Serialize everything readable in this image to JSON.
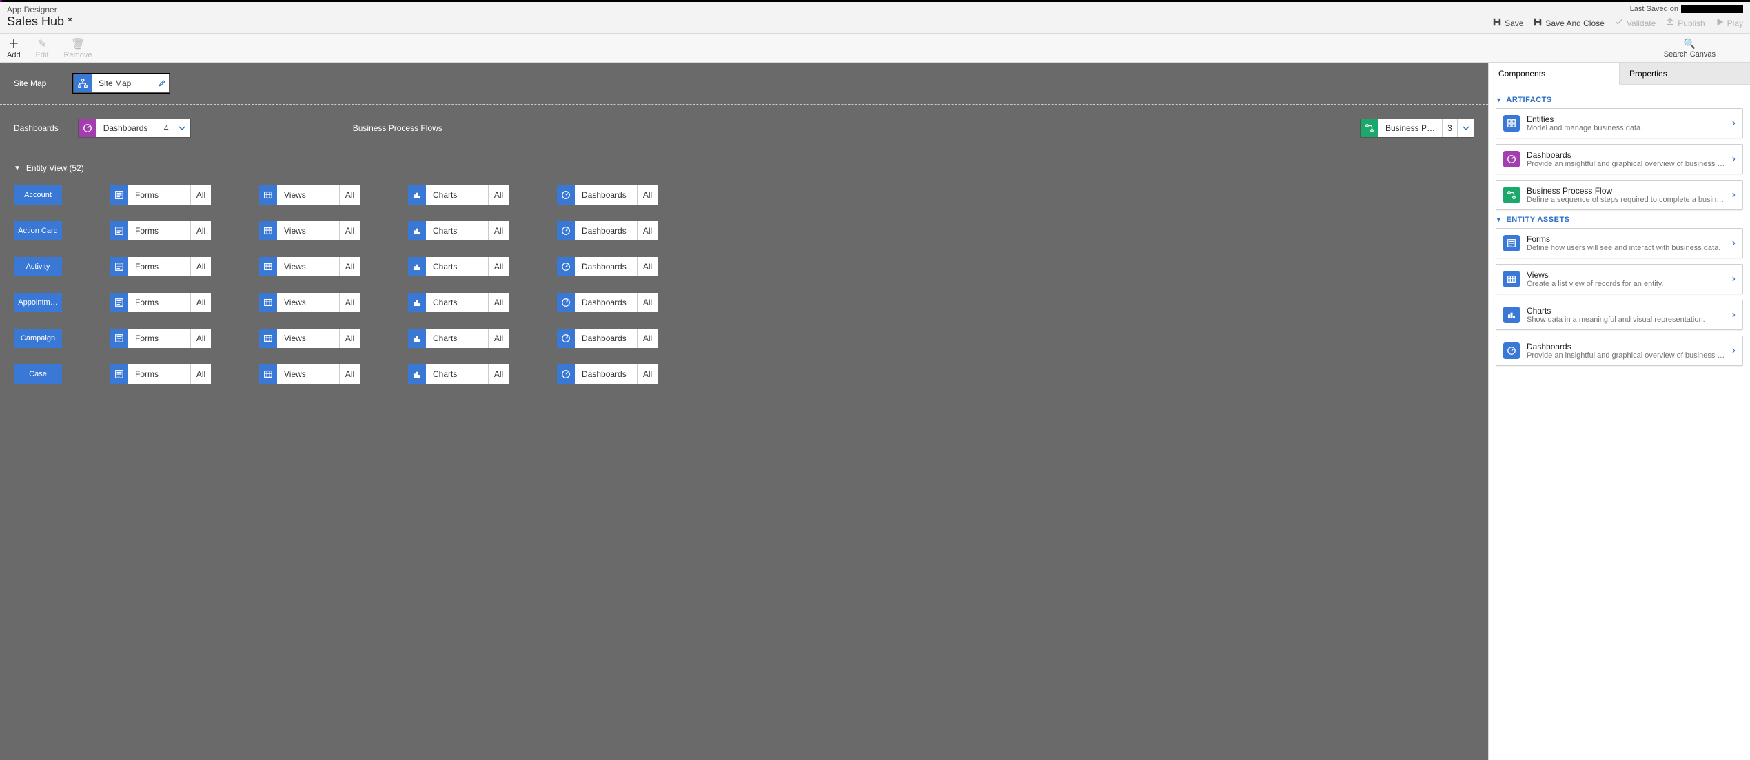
{
  "header": {
    "app_designer": "App Designer",
    "app_name": "Sales Hub *",
    "last_saved_label": "Last Saved on",
    "actions": {
      "save": "Save",
      "save_close": "Save And Close",
      "validate": "Validate",
      "publish": "Publish",
      "play": "Play"
    }
  },
  "toolbar": {
    "add": "Add",
    "edit": "Edit",
    "remove": "Remove",
    "search_canvas": "Search Canvas"
  },
  "canvas": {
    "sitemap_label": "Site Map",
    "sitemap_tile": "Site Map",
    "dashboards_label": "Dashboards",
    "dashboards_tile": "Dashboards",
    "dashboards_count": "4",
    "bpf_label": "Business Process Flows",
    "bpf_tile": "Business P…",
    "bpf_count": "3",
    "entity_view_label": "Entity View (52)",
    "asset_labels": {
      "forms": "Forms",
      "views": "Views",
      "charts": "Charts",
      "dashboards": "Dashboards"
    },
    "asset_all": "All",
    "entities": [
      {
        "name": "Account"
      },
      {
        "name": "Action Card"
      },
      {
        "name": "Activity"
      },
      {
        "name": "Appointm…"
      },
      {
        "name": "Campaign"
      },
      {
        "name": "Case"
      }
    ]
  },
  "rightpanel": {
    "tabs": {
      "components": "Components",
      "properties": "Properties"
    },
    "sections": {
      "artifacts": "ARTIFACTS",
      "entity_assets": "ENTITY ASSETS"
    },
    "artifacts": [
      {
        "title": "Entities",
        "desc": "Model and manage business data.",
        "color": "#3a78d6",
        "icon": "grid"
      },
      {
        "title": "Dashboards",
        "desc": "Provide an insightful and graphical overview of business data.",
        "color": "#a23eae",
        "icon": "gauge"
      },
      {
        "title": "Business Process Flow",
        "desc": "Define a sequence of steps required to complete a business proc…",
        "color": "#1aa86d",
        "icon": "flow"
      }
    ],
    "entity_assets": [
      {
        "title": "Forms",
        "desc": "Define how users will see and interact with business data.",
        "color": "#3a78d6",
        "icon": "form"
      },
      {
        "title": "Views",
        "desc": "Create a list view of records for an entity.",
        "color": "#3a78d6",
        "icon": "table"
      },
      {
        "title": "Charts",
        "desc": "Show data in a meaningful and visual representation.",
        "color": "#3a78d6",
        "icon": "bar"
      },
      {
        "title": "Dashboards",
        "desc": "Provide an insightful and graphical overview of business data.",
        "color": "#3a78d6",
        "icon": "gauge"
      }
    ]
  }
}
